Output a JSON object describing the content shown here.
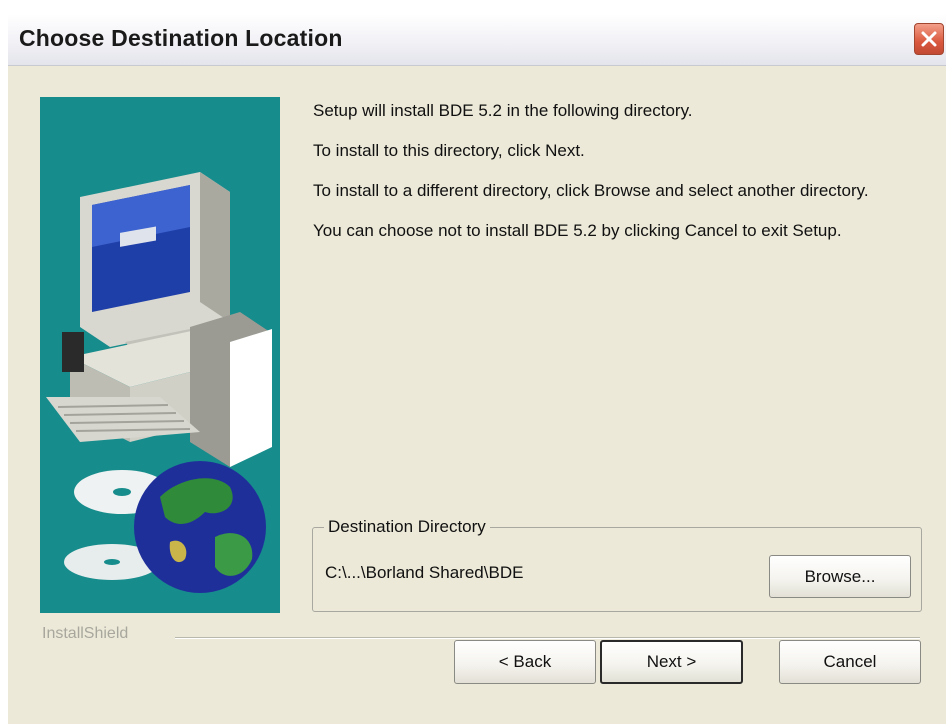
{
  "window": {
    "title": "Choose Destination Location"
  },
  "icons": {
    "close": "close-icon",
    "illustration": "computer-cd-globe-illustration"
  },
  "colors": {
    "illustration_bg": "#178c8c",
    "dialog_bg": "#ece9d8"
  },
  "content": {
    "line1": "Setup will install BDE 5.2 in the following directory.",
    "line2": "To install to this directory, click Next.",
    "line3": "To install to a different directory, click Browse and select another directory.",
    "line4": "You can choose not to install BDE 5.2 by clicking Cancel to exit Setup."
  },
  "destination": {
    "group_label": "Destination Directory",
    "path": "C:\\...\\Borland Shared\\BDE",
    "browse_label": "Browse..."
  },
  "footer": {
    "brand": "InstallShield",
    "back_label": "< Back",
    "next_label": "Next >",
    "cancel_label": "Cancel"
  }
}
